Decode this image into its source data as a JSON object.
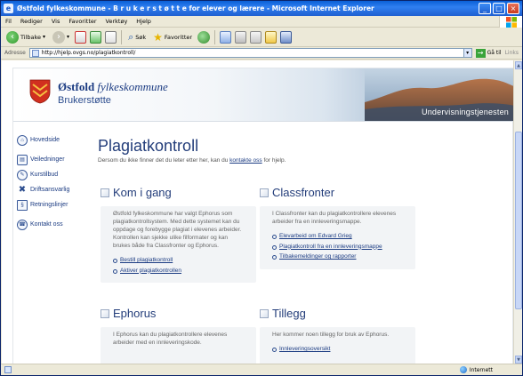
{
  "window": {
    "title": "Østfold fylkeskommune - B r u k e r s t ø t t e  for elever og lærere - Microsoft Internet Explorer",
    "menu": [
      "Fil",
      "Rediger",
      "Vis",
      "Favoritter",
      "Verktøy",
      "Hjelp"
    ],
    "toolbar": {
      "back": "Tilbake",
      "search": "Søk",
      "favorites": "Favoritter"
    },
    "address_label": "Adresse",
    "address_value": "http://hjelp.ovgs.no/plagiatkontroll/",
    "go_label": "Gå til",
    "links_label": "Links",
    "status_zone": "Internett"
  },
  "banner": {
    "org_prefix": "Østfold ",
    "org_suffix": "fylkeskommune",
    "site_name": "Brukerstøtte",
    "tagline": "Undervisningstjenesten"
  },
  "sidebar": {
    "items": [
      {
        "label": "Hovedside",
        "icon": "home-icon"
      },
      {
        "label": "Veiledninger",
        "icon": "guide-icon"
      },
      {
        "label": "Kurstilbud",
        "icon": "course-icon"
      },
      {
        "label": "Driftsansvarlig",
        "icon": "tools-icon"
      },
      {
        "label": "Retningslinjer",
        "icon": "rules-icon"
      },
      {
        "label": "Kontakt oss",
        "icon": "contact-icon"
      }
    ]
  },
  "main": {
    "title": "Plagiatkontroll",
    "subtitle_before": "Dersom du ikke finner det du leter etter her, kan du ",
    "subtitle_link": "kontakte oss",
    "subtitle_after": " for hjelp.",
    "sections": [
      {
        "heading": "Kom i gang",
        "text": "Østfold fylkeskommune har valgt Ephorus som plagiatkontrollsystem. Med dette systemet kan du oppdage og forebygge plagiat i elevenes arbeider. Kontrollen kan sjekke ulike filformater og kan brukes både fra Classfronter og Ephorus.",
        "links": [
          "Bestill plagiatkontroll",
          "Aktiver plagiatkontrollen"
        ]
      },
      {
        "heading": "Classfronter",
        "text": "I Classfronter kan du plagiatkontrollere elevenes arbeider fra en innleveringsmappe.",
        "links": [
          "Elevarbeid om Edvard Grieg",
          "Plagiatkontroll fra en innleveringsmappe",
          "Tilbakemeldinger og rapporter"
        ]
      },
      {
        "heading": "Ephorus",
        "text": "I Ephorus kan du plagiatkontrollere elevenes arbeider med en innleveringskode.",
        "links": []
      },
      {
        "heading": "Tillegg",
        "text": "Her kommer noen tillegg for bruk av Ephorus.",
        "links": [
          "Innleveringsoversikt"
        ]
      }
    ]
  },
  "colors": {
    "brand_blue": "#1b3b82",
    "title_blue": "#233d7a",
    "xp_title": "#0a5fd6"
  }
}
